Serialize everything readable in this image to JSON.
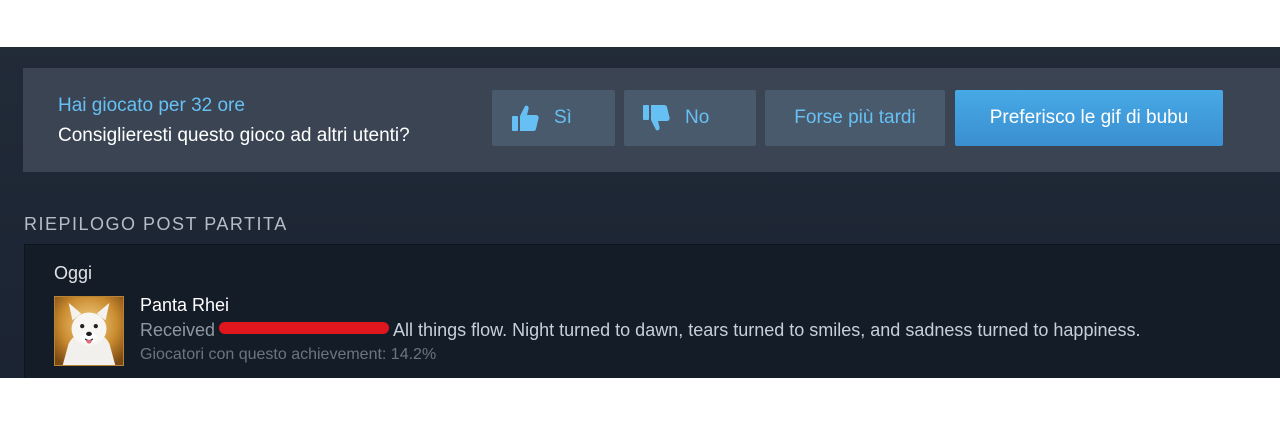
{
  "review": {
    "hours_played": "Hai giocato per 32 ore",
    "question": "Consiglieresti questo gioco ad altri utenti?",
    "buttons": {
      "yes": "Sì",
      "no": "No",
      "later": "Forse più tardi",
      "gif": "Preferisco le gif di bubu"
    },
    "icons": {
      "yes": "thumbs-up-icon",
      "no": "thumbs-down-icon"
    }
  },
  "summary": {
    "title": "RIEPILOGO POST PARTITA",
    "day": "Oggi",
    "achievement": {
      "name": "Panta Rhei",
      "received_prefix": "Received",
      "description": "All things flow. Night turned to dawn, tears turned to smiles, and sadness turned to happiness.",
      "players_stat": "Giocatori con questo achievement: 14.2%",
      "players_percent": 14.2,
      "icon": "samoyed-dog-achievement-icon"
    }
  },
  "colors": {
    "accent": "#66c0f4",
    "button_bg": "#4a5a6d",
    "primary_button": "#47a9e6",
    "redaction": "#e0161f"
  }
}
